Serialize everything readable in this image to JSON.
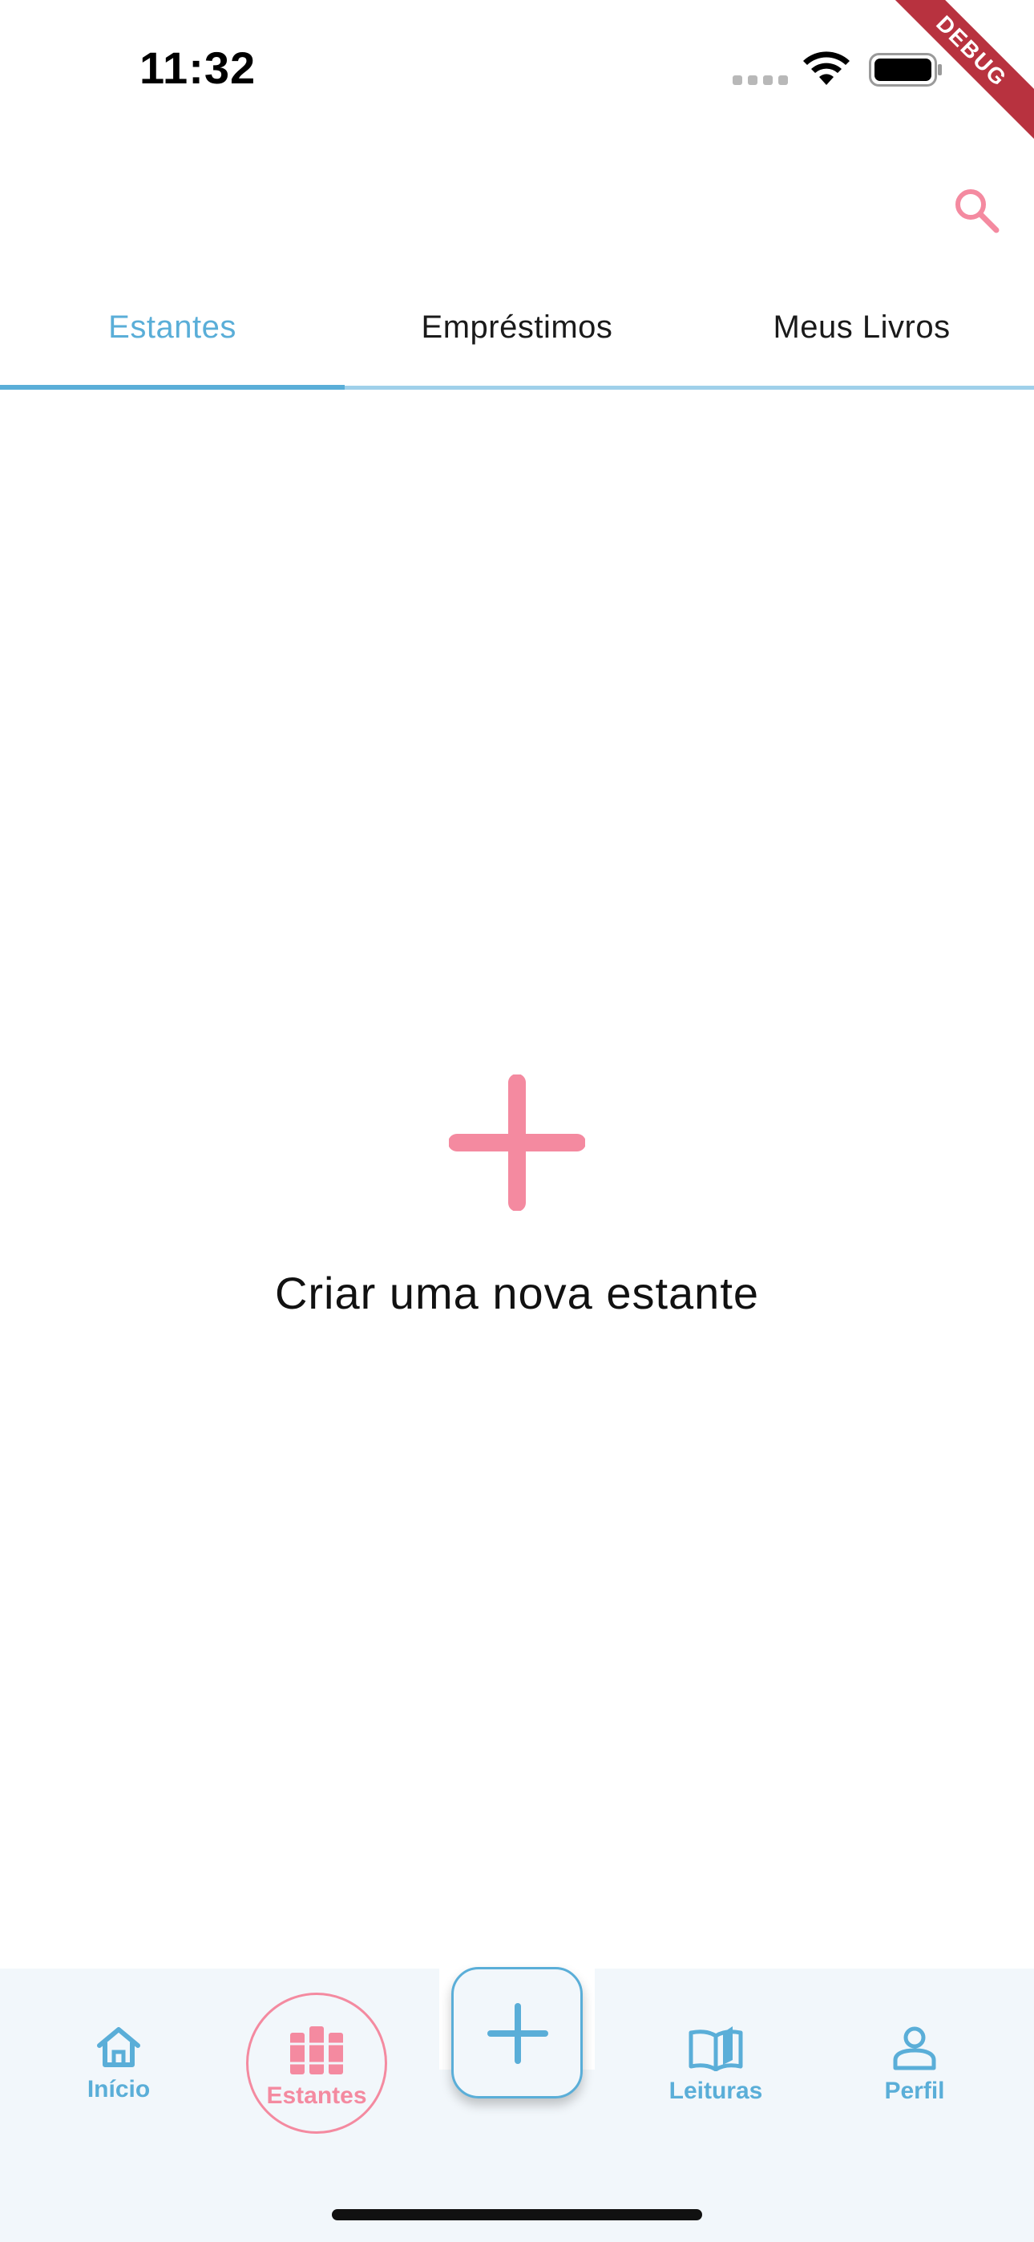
{
  "status_bar": {
    "time": "11:32",
    "icons": [
      "cellular-signal-icon",
      "wifi-icon",
      "battery-icon"
    ]
  },
  "debug_banner": {
    "label": "DEBUG",
    "color": "#b8323f"
  },
  "header": {
    "search_icon": "search-icon"
  },
  "tabs": [
    {
      "label": "Estantes",
      "active": true
    },
    {
      "label": "Empréstimos",
      "active": false
    },
    {
      "label": "Meus Livros",
      "active": false
    }
  ],
  "empty_state": {
    "icon": "plus-icon",
    "label": "Criar uma nova estante"
  },
  "bottom_nav": {
    "items": [
      {
        "label": "Início",
        "icon": "home-icon",
        "active": false
      },
      {
        "label": "Estantes",
        "icon": "bookshelf-icon",
        "active": true
      },
      {
        "label": "Leituras",
        "icon": "open-book-icon",
        "active": false
      },
      {
        "label": "Perfil",
        "icon": "person-icon",
        "active": false
      }
    ],
    "fab_icon": "plus-icon"
  },
  "colors": {
    "primary_blue": "#5aaed8",
    "accent_pink": "#f48aa0",
    "nav_background": "#f2f7fb"
  }
}
